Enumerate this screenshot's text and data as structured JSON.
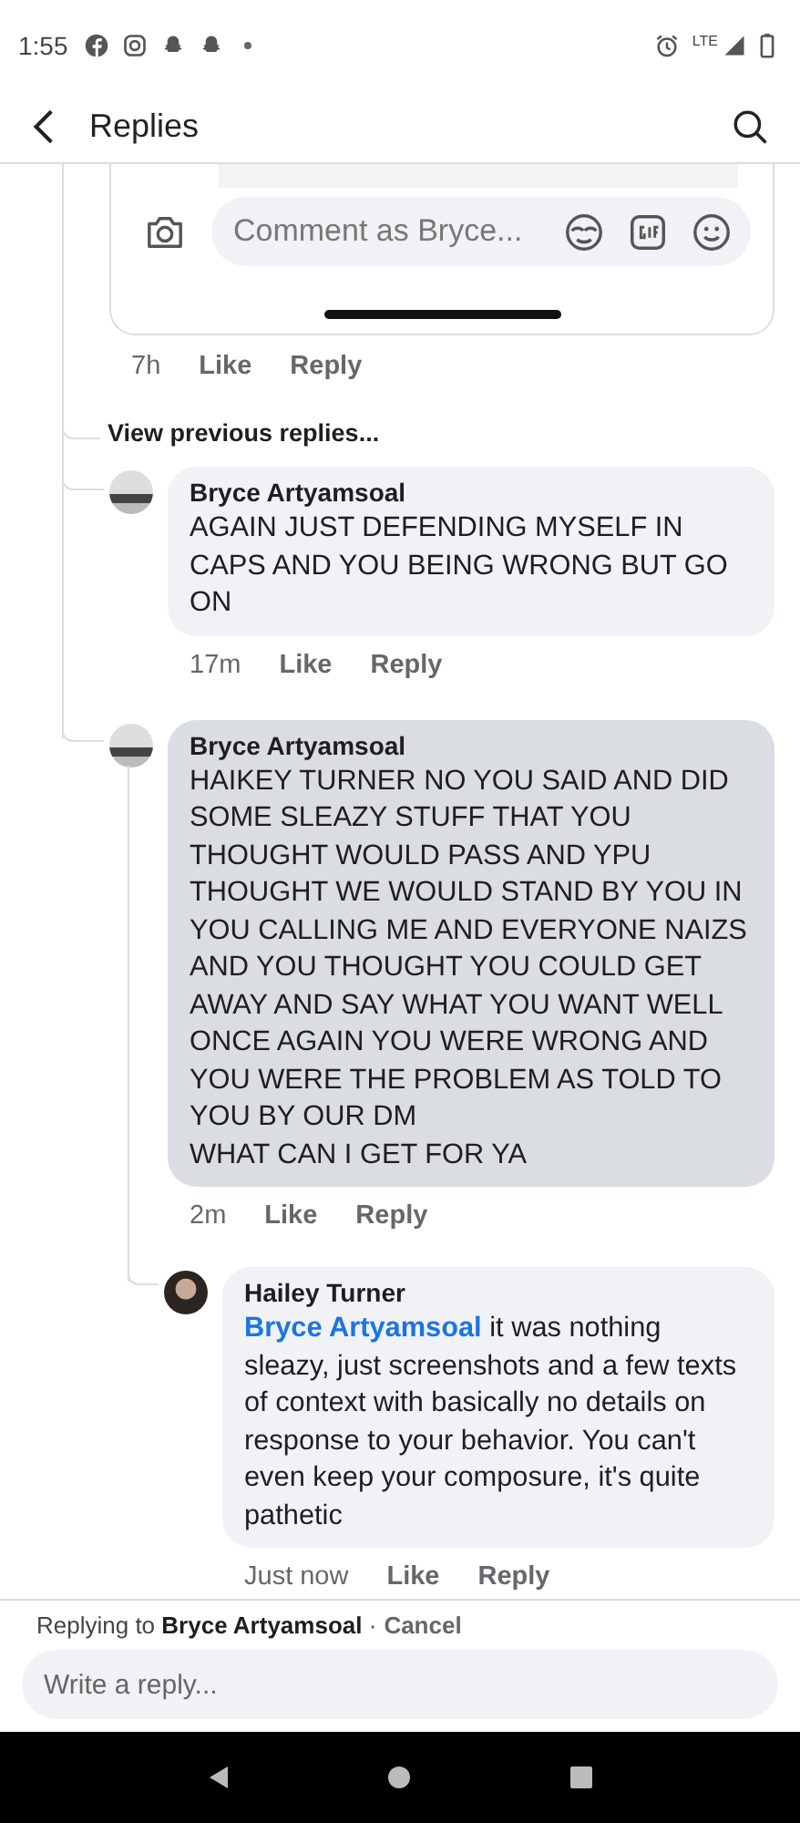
{
  "status_bar": {
    "time": "1:55",
    "network": "LTE"
  },
  "header": {
    "title": "Replies"
  },
  "parent_comment": {
    "composer": {
      "placeholder": "Comment as Bryce..."
    },
    "time": "7h",
    "actions": [
      "Like",
      "Reply"
    ]
  },
  "view_previous": "View previous replies...",
  "comments": [
    {
      "author": "Bryce Artyamsoal",
      "text": "AGAIN JUST DEFENDING MYSELF IN CAPS AND YOU BEING WRONG BUT GO ON",
      "time": "17m",
      "actions": [
        "Like",
        "Reply"
      ],
      "highlighted": false
    },
    {
      "author": "Bryce Artyamsoal",
      "text": "HAIKEY TURNER NO YOU SAID AND DID SOME SLEAZY STUFF THAT YOU THOUGHT WOULD PASS AND YPU THOUGHT WE WOULD STAND BY YOU IN YOU CALLING ME AND EVERYONE NAIZS AND YOU THOUGHT YOU COULD GET AWAY AND SAY WHAT YOU WANT WELL ONCE AGAIN YOU WERE WRONG AND YOU WERE THE PROBLEM AS TOLD TO YOU BY OUR DM\nWHAT CAN I GET FOR YA",
      "time": "2m",
      "actions": [
        "Like",
        "Reply"
      ],
      "highlighted": true,
      "children": [
        {
          "author": "Hailey Turner",
          "mention": "Bryce Artyamsoal",
          "text": "it was nothing sleazy, just screenshots and a few texts of context with basically no details on response to your behavior. You can't even keep your composure, it's quite pathetic",
          "time": "Just now",
          "actions": [
            "Like",
            "Reply"
          ],
          "highlighted": false
        }
      ]
    }
  ],
  "reply_bar": {
    "context": "Replying to **Bryce Artyamsoal** ·",
    "cancel": "Cancel"
  },
  "reply_input": {
    "placeholder": "Write a reply..."
  }
}
